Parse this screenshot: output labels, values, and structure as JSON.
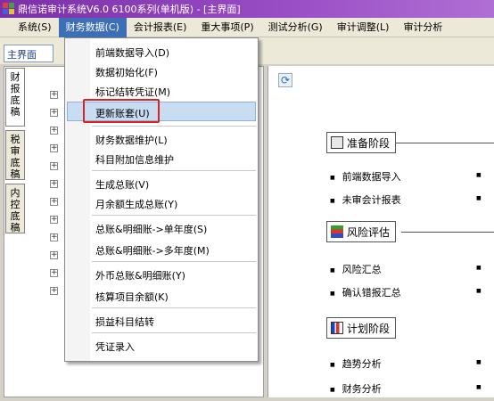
{
  "window": {
    "title": "鼎信诺审计系统V6.0 6100系列(单机版) - [主界面]"
  },
  "menubar": [
    {
      "label": "系统(S)"
    },
    {
      "label": "财务数据(C)"
    },
    {
      "label": "会计报表(E)"
    },
    {
      "label": "重大事项(P)"
    },
    {
      "label": "测试分析(G)"
    },
    {
      "label": "审计调整(L)"
    },
    {
      "label": "审计分析"
    }
  ],
  "main_tab": {
    "label": "主界面"
  },
  "vertical_tabs": [
    {
      "label": "财报底稿"
    },
    {
      "label": "税审底稿"
    },
    {
      "label": "内控底稿"
    }
  ],
  "dropdown": {
    "items": [
      {
        "label": "前端数据导入(D)"
      },
      {
        "label": "数据初始化(F)"
      },
      {
        "label": "标记结转凭证(M)"
      },
      {
        "label": "更新账套(U)"
      },
      {
        "label": "财务数据维护(L)"
      },
      {
        "label": "科目附加信息维护"
      },
      {
        "label": "生成总账(V)"
      },
      {
        "label": "月余额生成总账(Y)"
      },
      {
        "label": "总账&明细账->单年度(S)"
      },
      {
        "label": "总账&明细账->多年度(M)"
      },
      {
        "label": "外币总账&明细账(Y)"
      },
      {
        "label": "核算项目余额(K)"
      },
      {
        "label": "损益科目结转"
      },
      {
        "label": "凭证录入"
      }
    ]
  },
  "phases": [
    {
      "label": "准备阶段",
      "items": [
        "前端数据导入",
        "未审会计报表"
      ]
    },
    {
      "label": "风险评估",
      "items": [
        "风险汇总",
        "确认错报汇总"
      ]
    },
    {
      "label": "计划阶段",
      "items": [
        "趋势分析",
        "财务分析"
      ]
    }
  ],
  "colors": {
    "title_bar": "#7b2fa8",
    "menu_active": "#3d6fb6",
    "highlight": "#c8dcf2",
    "annotation_box": "#e02020"
  }
}
